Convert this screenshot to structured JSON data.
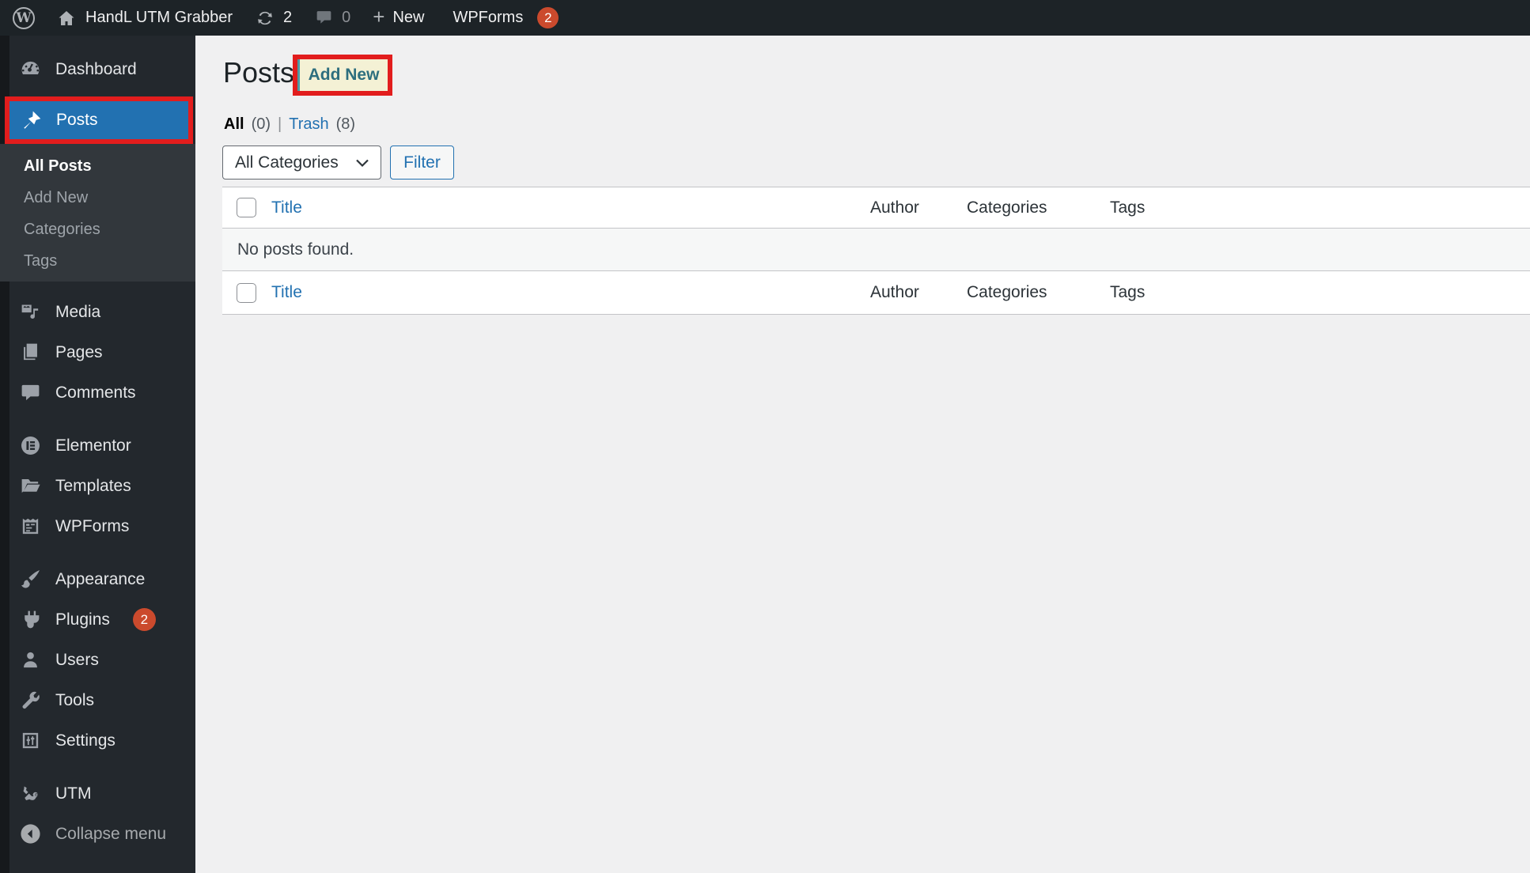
{
  "admin_bar": {
    "wp_logo_glyph": "W",
    "site_name": "HandL UTM Grabber",
    "update_count": "2",
    "comment_count": "0",
    "new_label": "New",
    "new_plus": "+",
    "wpforms_label": "WPForms",
    "wpforms_badge": "2"
  },
  "sidebar": {
    "items": [
      {
        "label": "Dashboard",
        "icon": "dashboard-icon"
      },
      {
        "label": "Posts",
        "icon": "pin-icon",
        "active": true,
        "highlighted": true
      },
      {
        "label": "Media",
        "icon": "media-icon"
      },
      {
        "label": "Pages",
        "icon": "pages-icon"
      },
      {
        "label": "Comments",
        "icon": "comments-icon"
      },
      {
        "label": "Elementor",
        "icon": "elementor-icon"
      },
      {
        "label": "Templates",
        "icon": "folder-icon"
      },
      {
        "label": "WPForms",
        "icon": "wpforms-icon"
      },
      {
        "label": "Appearance",
        "icon": "brush-icon"
      },
      {
        "label": "Plugins",
        "icon": "plugin-icon",
        "badge": "2"
      },
      {
        "label": "Users",
        "icon": "user-icon"
      },
      {
        "label": "Tools",
        "icon": "wrench-icon"
      },
      {
        "label": "Settings",
        "icon": "sliders-icon"
      },
      {
        "label": "UTM",
        "icon": "utm-icon"
      }
    ],
    "posts_submenu": [
      {
        "label": "All Posts",
        "current": true
      },
      {
        "label": "Add New"
      },
      {
        "label": "Categories"
      },
      {
        "label": "Tags"
      }
    ],
    "collapse_label": "Collapse menu"
  },
  "main": {
    "title": "Posts",
    "add_new_label": "Add New",
    "views": {
      "all_label": "All",
      "all_count": "(0)",
      "separator": "|",
      "trash_label": "Trash",
      "trash_count": "(8)"
    },
    "category_select_value": "All Categories",
    "filter_button_label": "Filter",
    "table": {
      "columns": [
        "Title",
        "Author",
        "Categories",
        "Tags"
      ],
      "empty_message": "No posts found."
    }
  },
  "colors": {
    "accent": "#2271b1",
    "highlight": "#e21d1d",
    "badge": "#cb4a2d",
    "adminbar": "#1d2327",
    "sidebar": "#23282d",
    "submenu": "#32373c",
    "content": "#f0f0f1",
    "addnew-bg": "#f4f1d5",
    "addnew-ink": "#2d6e7e"
  }
}
